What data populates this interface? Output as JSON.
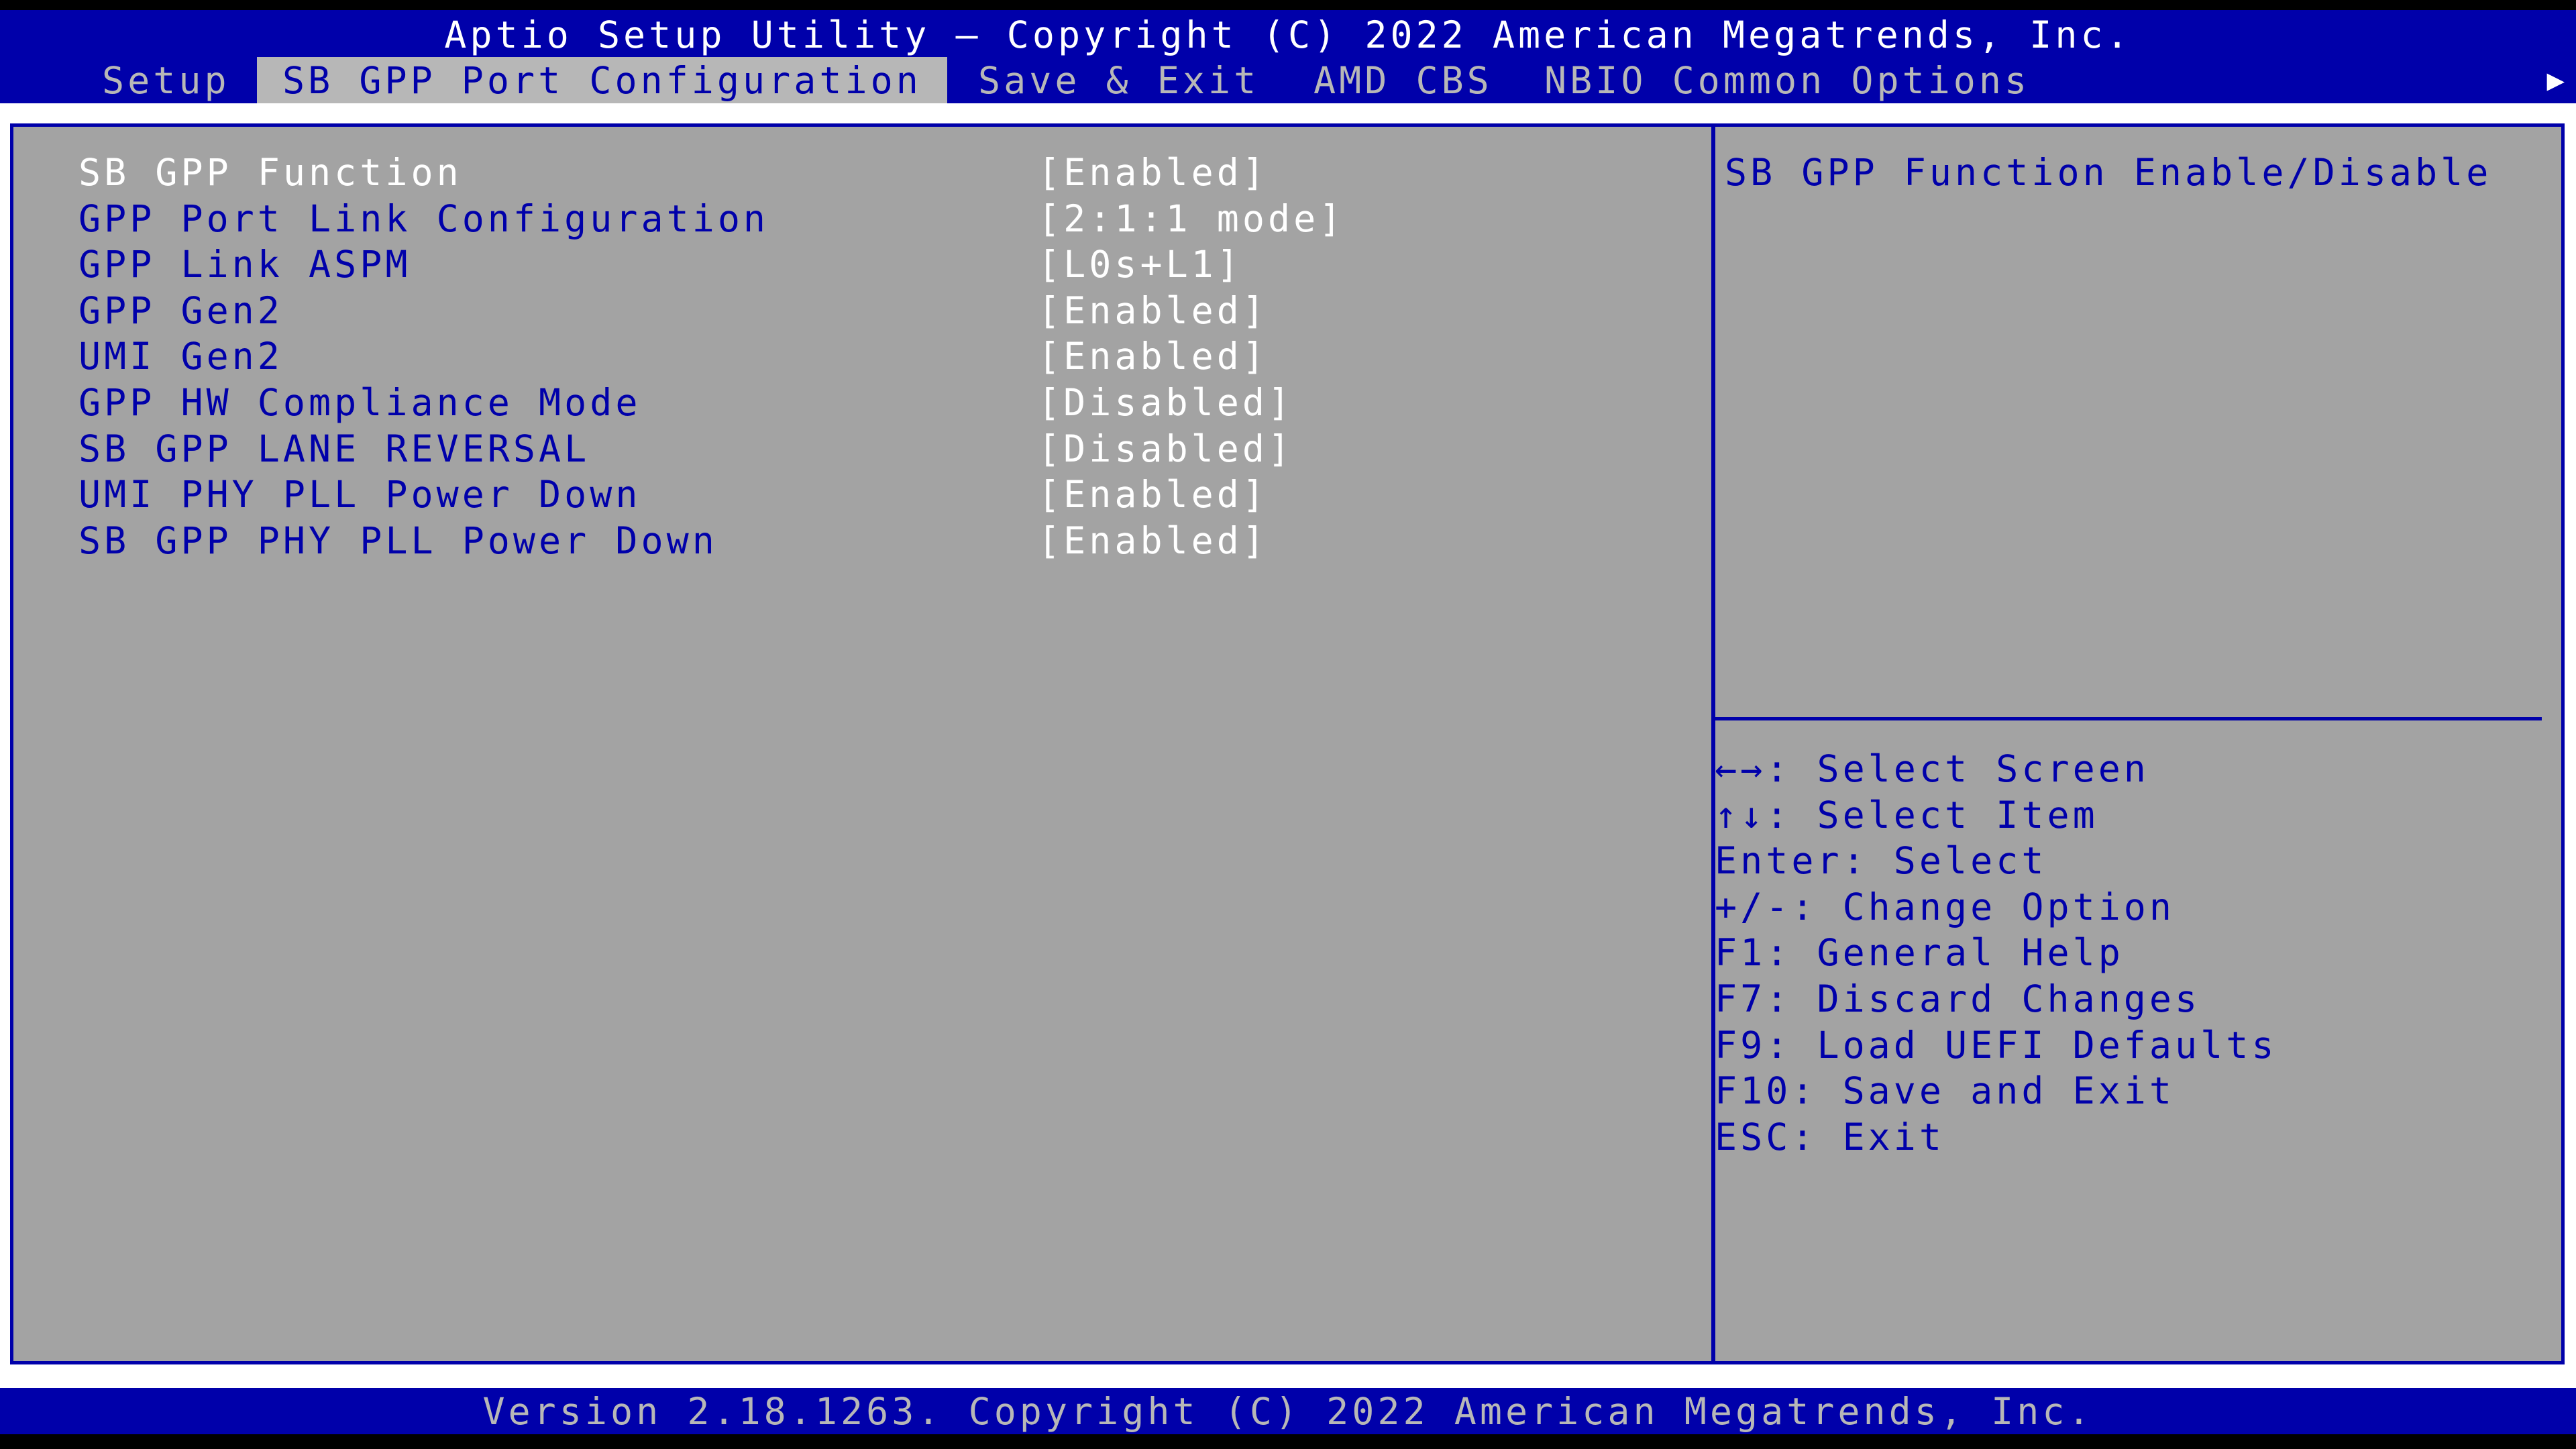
{
  "title": "Aptio Setup Utility – Copyright (C) 2022 American Megatrends, Inc.",
  "menu": {
    "tabs": [
      {
        "label": "Setup"
      },
      {
        "label": "SB GPP Port Configuration"
      },
      {
        "label": "Save & Exit"
      },
      {
        "label": "AMD CBS"
      },
      {
        "label": "NBIO Common Options"
      }
    ],
    "active_tab": "SB GPP Port Configuration",
    "more_arrow": "▶"
  },
  "settings": [
    {
      "label": "SB GPP Function",
      "value": "[Enabled]"
    },
    {
      "label": "GPP Port Link Configuration",
      "value": "[2:1:1 mode]"
    },
    {
      "label": "GPP Link ASPM",
      "value": "[L0s+L1]"
    },
    {
      "label": "GPP Gen2",
      "value": "[Enabled]"
    },
    {
      "label": "UMI Gen2",
      "value": "[Enabled]"
    },
    {
      "label": "GPP HW Compliance Mode",
      "value": "[Disabled]"
    },
    {
      "label": "SB GPP LANE REVERSAL",
      "value": "[Disabled]"
    },
    {
      "label": "UMI PHY PLL Power Down",
      "value": "[Enabled]"
    },
    {
      "label": "SB GPP PHY PLL Power Down",
      "value": "[Enabled]"
    }
  ],
  "selected_setting": "SB GPP Function",
  "help": {
    "description": "SB GPP Function Enable/Disable",
    "keys": [
      "←→: Select Screen",
      "↑↓: Select Item",
      "Enter: Select",
      "+/-: Change Option",
      "F1: General Help",
      "F7: Discard Changes",
      "F9: Load UEFI Defaults",
      "F10: Save and Exit",
      "ESC: Exit"
    ]
  },
  "footer": "Version 2.18.1263. Copyright (C) 2022 American Megatrends, Inc.",
  "colors": {
    "bios_blue": "#0000aa",
    "panel_gray": "#a3a3a3",
    "menu_text_gray": "#b7b7b7",
    "highlight_white": "#ffffff"
  }
}
